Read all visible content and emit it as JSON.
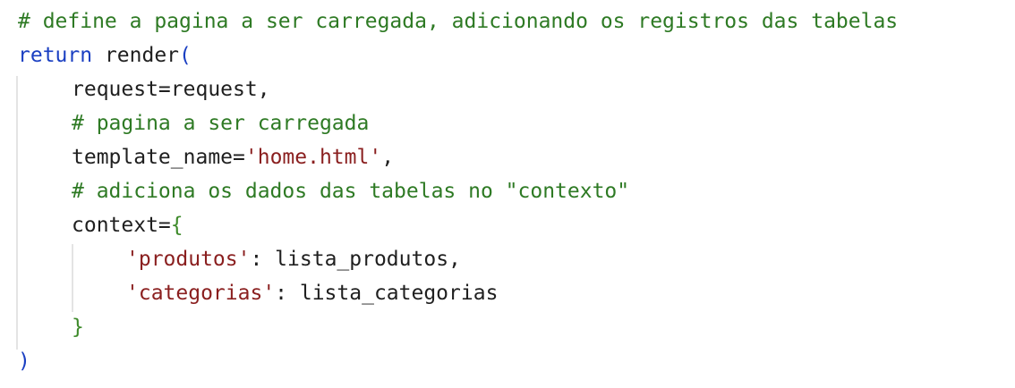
{
  "code": {
    "line1": {
      "comment": "# define a pagina a ser carregada, adicionando os registros das tabelas"
    },
    "line2": {
      "keyword": "return",
      "plain": " render",
      "paren": "("
    },
    "line3": {
      "plain": "request=request,"
    },
    "line4": {
      "comment": "# pagina a ser carregada"
    },
    "line5": {
      "plain": "template_name=",
      "string": "'home.html'",
      "tail": ","
    },
    "line6": {
      "comment": "# adiciona os dados das tabelas no \"contexto\""
    },
    "line7": {
      "plain": "context=",
      "brace": "{"
    },
    "line8": {
      "string": "'produtos'",
      "plain": ": lista_produtos,"
    },
    "line9": {
      "string": "'categorias'",
      "plain": ": lista_categorias"
    },
    "line10": {
      "brace": "}"
    },
    "line11": {
      "paren": ")"
    }
  }
}
